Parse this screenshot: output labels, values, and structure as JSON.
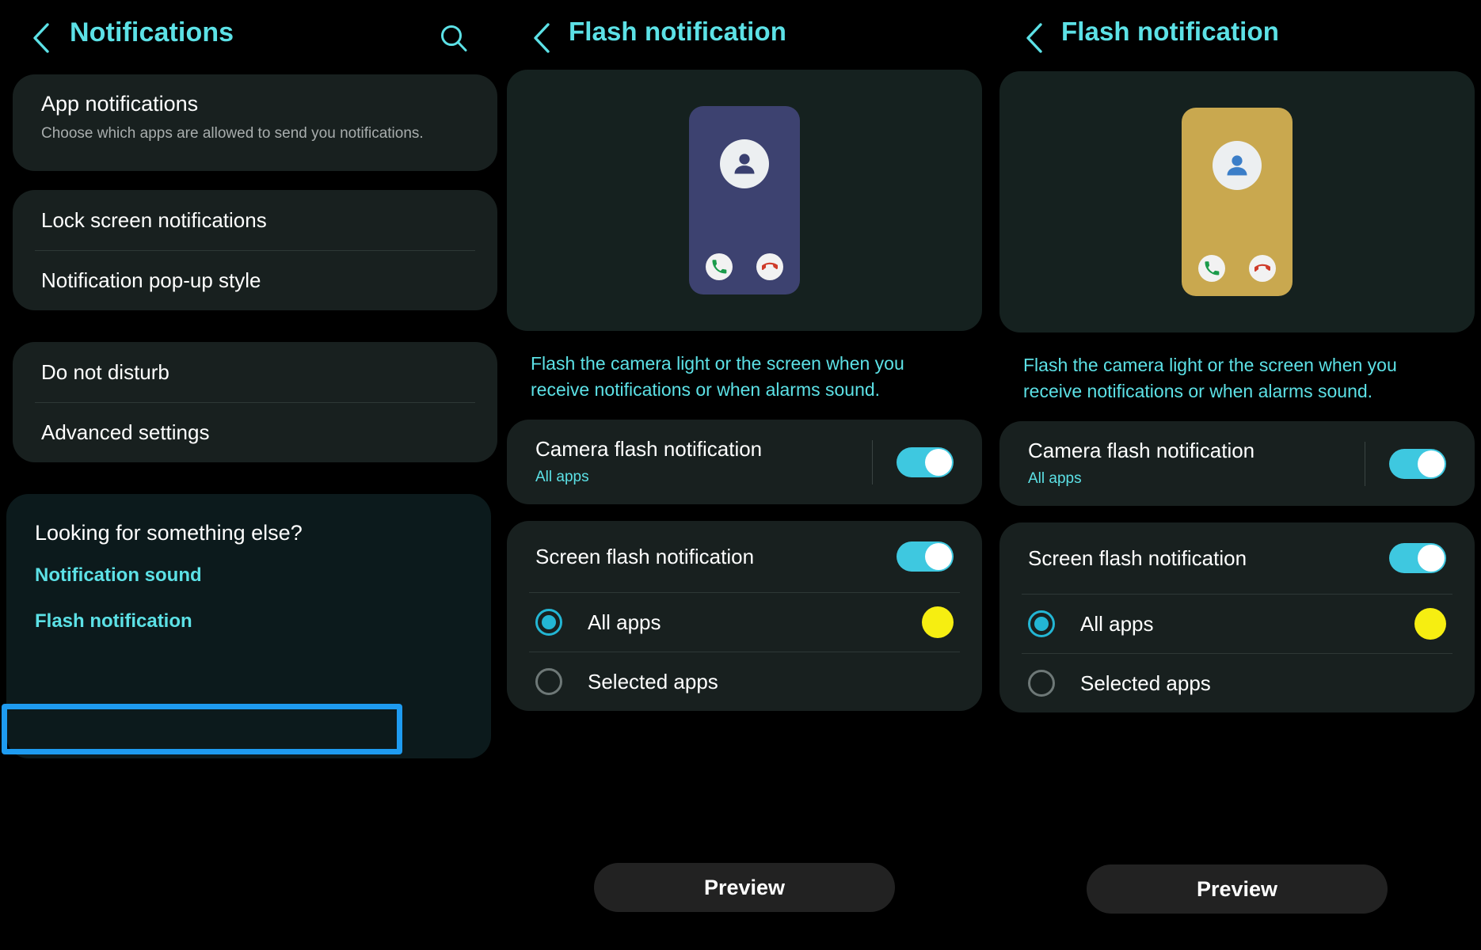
{
  "colors": {
    "accent_cyan": "#5ce1e6",
    "toggle_on": "#3ec8e0",
    "radio_on": "#23b6d4",
    "swatch_yellow": "#f6ee11",
    "highlight_blue": "#1e9bf0",
    "card_bg": "#18201f",
    "page_bg": "#000000",
    "phone_mock_mid": "#3d4270",
    "phone_mock_right": "#c9a84f"
  },
  "panel_left": {
    "header": {
      "title": "Notifications",
      "back_icon": "chevron-left-icon",
      "search_icon": "search-icon"
    },
    "card_app_notifications": {
      "title": "App notifications",
      "subtitle": "Choose which apps are allowed to send you notifications."
    },
    "card_lock": {
      "items": [
        {
          "label": "Lock screen notifications"
        },
        {
          "label": "Notification pop-up style"
        }
      ]
    },
    "card_dnd": {
      "items": [
        {
          "label": "Do not disturb"
        },
        {
          "label": "Advanced settings"
        }
      ]
    },
    "card_else": {
      "heading": "Looking for something else?",
      "links": [
        {
          "label": "Notification sound",
          "highlighted": false
        },
        {
          "label": "Flash notification",
          "highlighted": true
        }
      ]
    }
  },
  "panel_mid": {
    "header": {
      "title": "Flash notification",
      "back_icon": "chevron-left-icon"
    },
    "preview": {
      "phone_color": "#3d4270",
      "avatar_icon": "person-icon",
      "answer_icon": "phone-answer-icon",
      "decline_icon": "phone-decline-icon"
    },
    "description": "Flash the camera light or the screen when you receive notifications or when alarms sound.",
    "camera_flash": {
      "title": "Camera flash notification",
      "subtitle": "All apps",
      "toggle": "on"
    },
    "screen_flash": {
      "title": "Screen flash notification",
      "toggle": "on",
      "options": [
        {
          "label": "All apps",
          "selected": true,
          "swatch": "#f6ee11"
        },
        {
          "label": "Selected apps",
          "selected": false
        }
      ]
    },
    "preview_button": "Preview"
  },
  "panel_right": {
    "header": {
      "title": "Flash notification",
      "back_icon": "chevron-left-icon"
    },
    "preview": {
      "phone_color": "#c9a84f",
      "avatar_icon": "person-icon",
      "answer_icon": "phone-answer-icon",
      "decline_icon": "phone-decline-icon"
    },
    "description": "Flash the camera light or the screen when you receive notifications or when alarms sound.",
    "camera_flash": {
      "title": "Camera flash notification",
      "subtitle": "All apps",
      "toggle": "on"
    },
    "screen_flash": {
      "title": "Screen flash notification",
      "toggle": "on",
      "options": [
        {
          "label": "All apps",
          "selected": true,
          "swatch": "#f6ee11"
        },
        {
          "label": "Selected apps",
          "selected": false
        }
      ]
    },
    "preview_button": "Preview"
  }
}
